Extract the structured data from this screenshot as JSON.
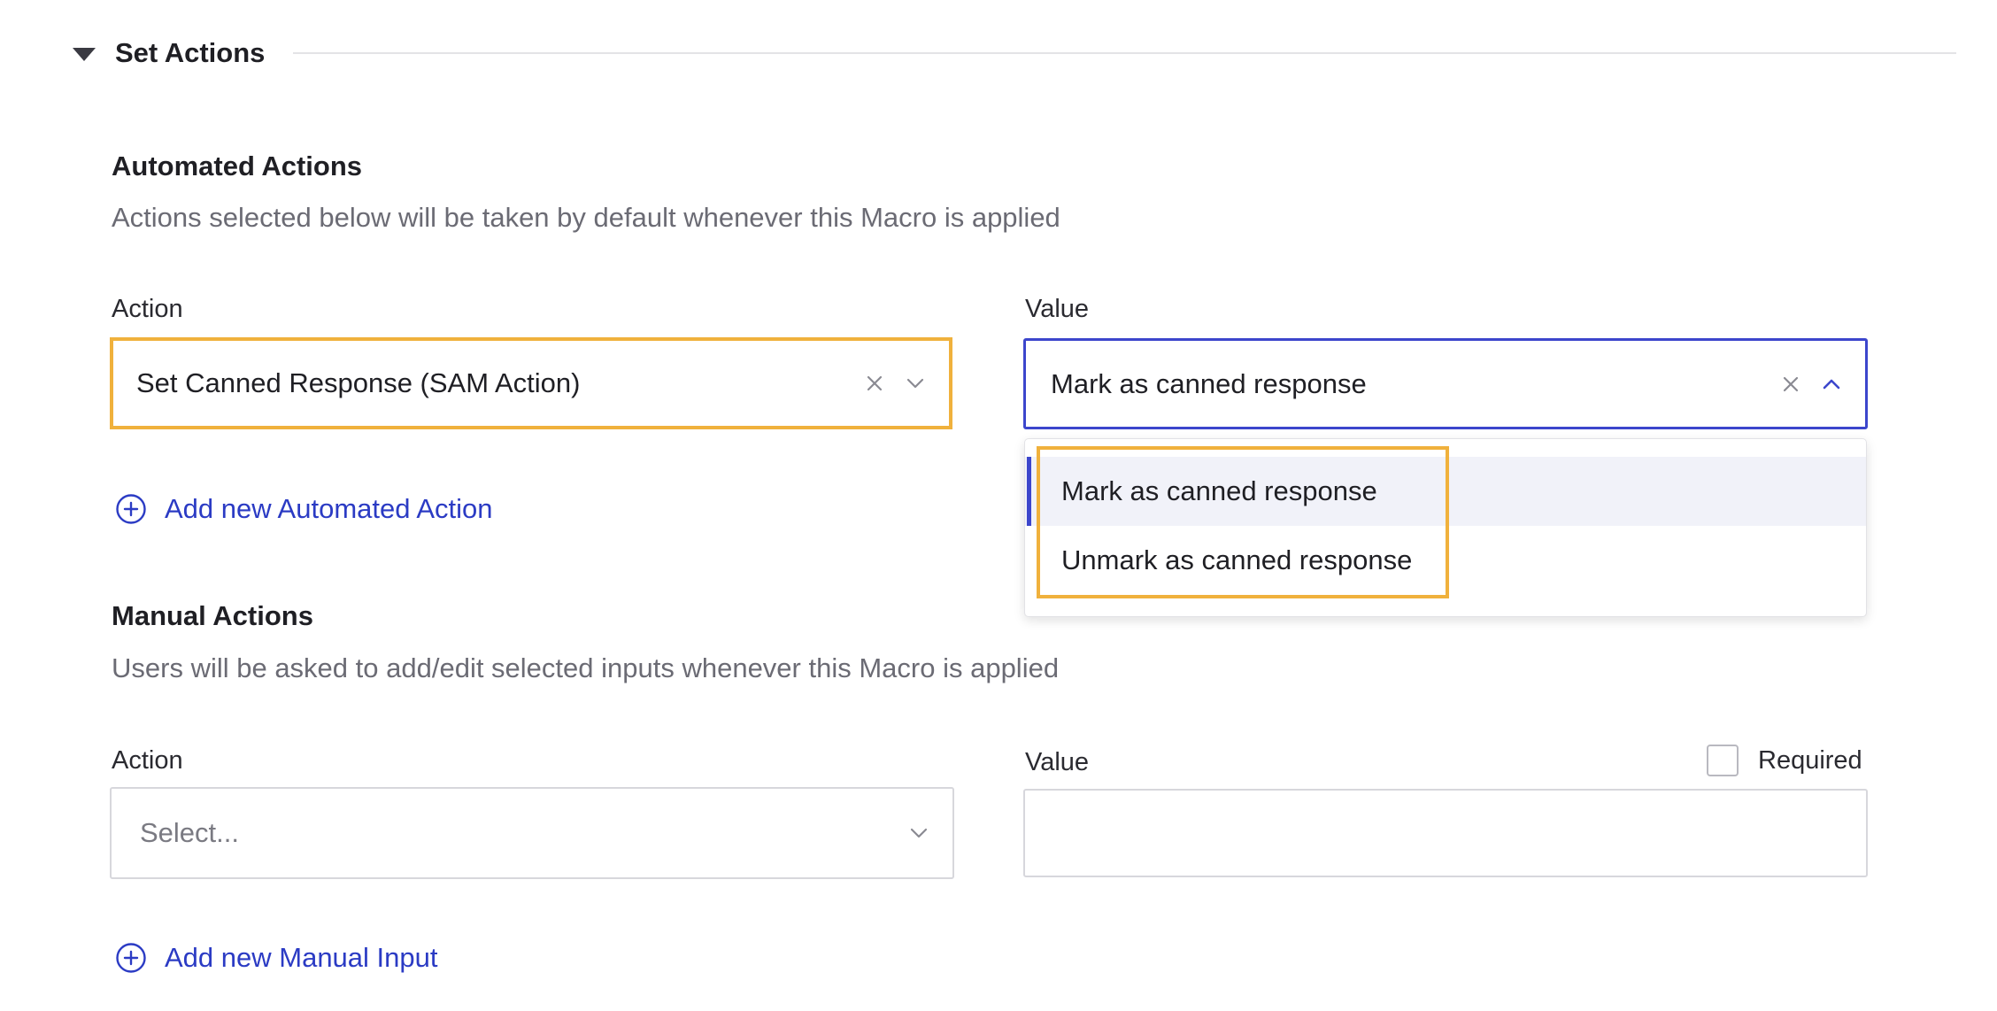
{
  "section": {
    "title": "Set Actions"
  },
  "automated": {
    "heading": "Automated Actions",
    "description": "Actions selected below will be taken by default whenever this Macro is applied",
    "action_label": "Action",
    "value_label": "Value",
    "action_value": "Set Canned Response (SAM Action)",
    "value_value": "Mark as canned response",
    "options": [
      "Mark as canned response",
      "Unmark as canned response"
    ],
    "add_link": "Add new Automated Action"
  },
  "manual": {
    "heading": "Manual Actions",
    "description": "Users will be asked to add/edit selected inputs whenever this Macro is applied",
    "action_label": "Action",
    "value_label": "Value",
    "required_label": "Required",
    "action_placeholder": "Select...",
    "add_link": "Add new Manual Input"
  },
  "colors": {
    "accent": "#3c46cc",
    "highlight": "#f0b13c",
    "link": "#2b3bc4"
  }
}
